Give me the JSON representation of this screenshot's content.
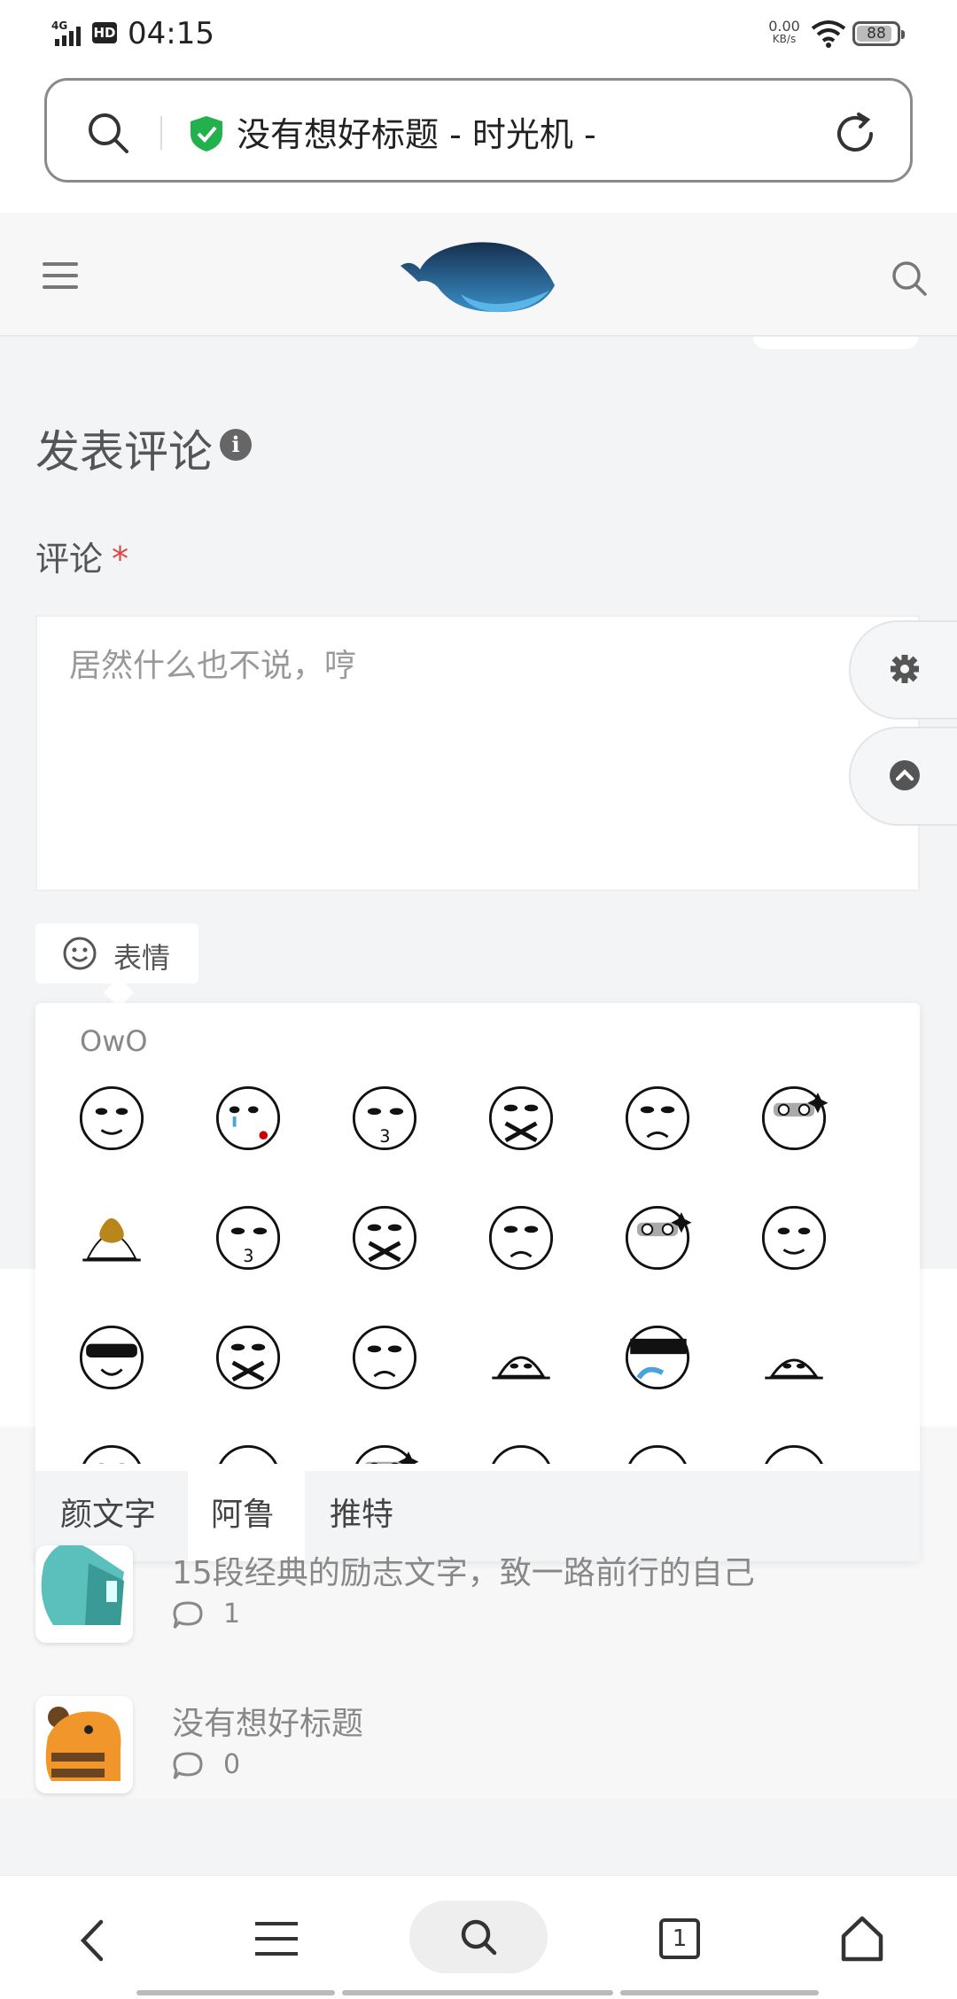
{
  "status": {
    "time": "04:15",
    "network": "4G",
    "hd": "HD",
    "speed_value": "0.00",
    "speed_unit": "KB/s",
    "battery": "88"
  },
  "browser": {
    "page_title": "没有想好标题 - 时光机 -",
    "tab_count": "1"
  },
  "form": {
    "title": "发表评论",
    "comment_label": "评论",
    "required_mark": "*",
    "placeholder": "居然什么也不说，哼",
    "emoji_button": "表情"
  },
  "emoji_panel": {
    "title": "OwO",
    "tabs": [
      "颜文字",
      "阿鲁",
      "推特"
    ],
    "active_tab": "阿鲁",
    "emojis": [
      "中指",
      "吐血",
      "献吻",
      "不说话",
      "不高兴",
      "得意",
      "便便",
      "哭泣",
      "捂脸",
      "阴暗",
      "咧嘴",
      "无所谓",
      "投降",
      "观察",
      "墨镜哭",
      "装大款",
      "喷血",
      "黑线",
      "眼泪",
      "惊吓",
      "汗",
      "亲亲",
      "害羞",
      "无语"
    ]
  },
  "posts": [
    {
      "title": "15段经典的励志文字，致一路前行的自己",
      "comments": "1"
    },
    {
      "title": "没有想好标题",
      "comments": "0"
    }
  ],
  "colors": {
    "accent_green": "#22b14c",
    "required_red": "#dd4444",
    "whale_dark": "#16304f",
    "whale_light": "#3a8fc9"
  }
}
